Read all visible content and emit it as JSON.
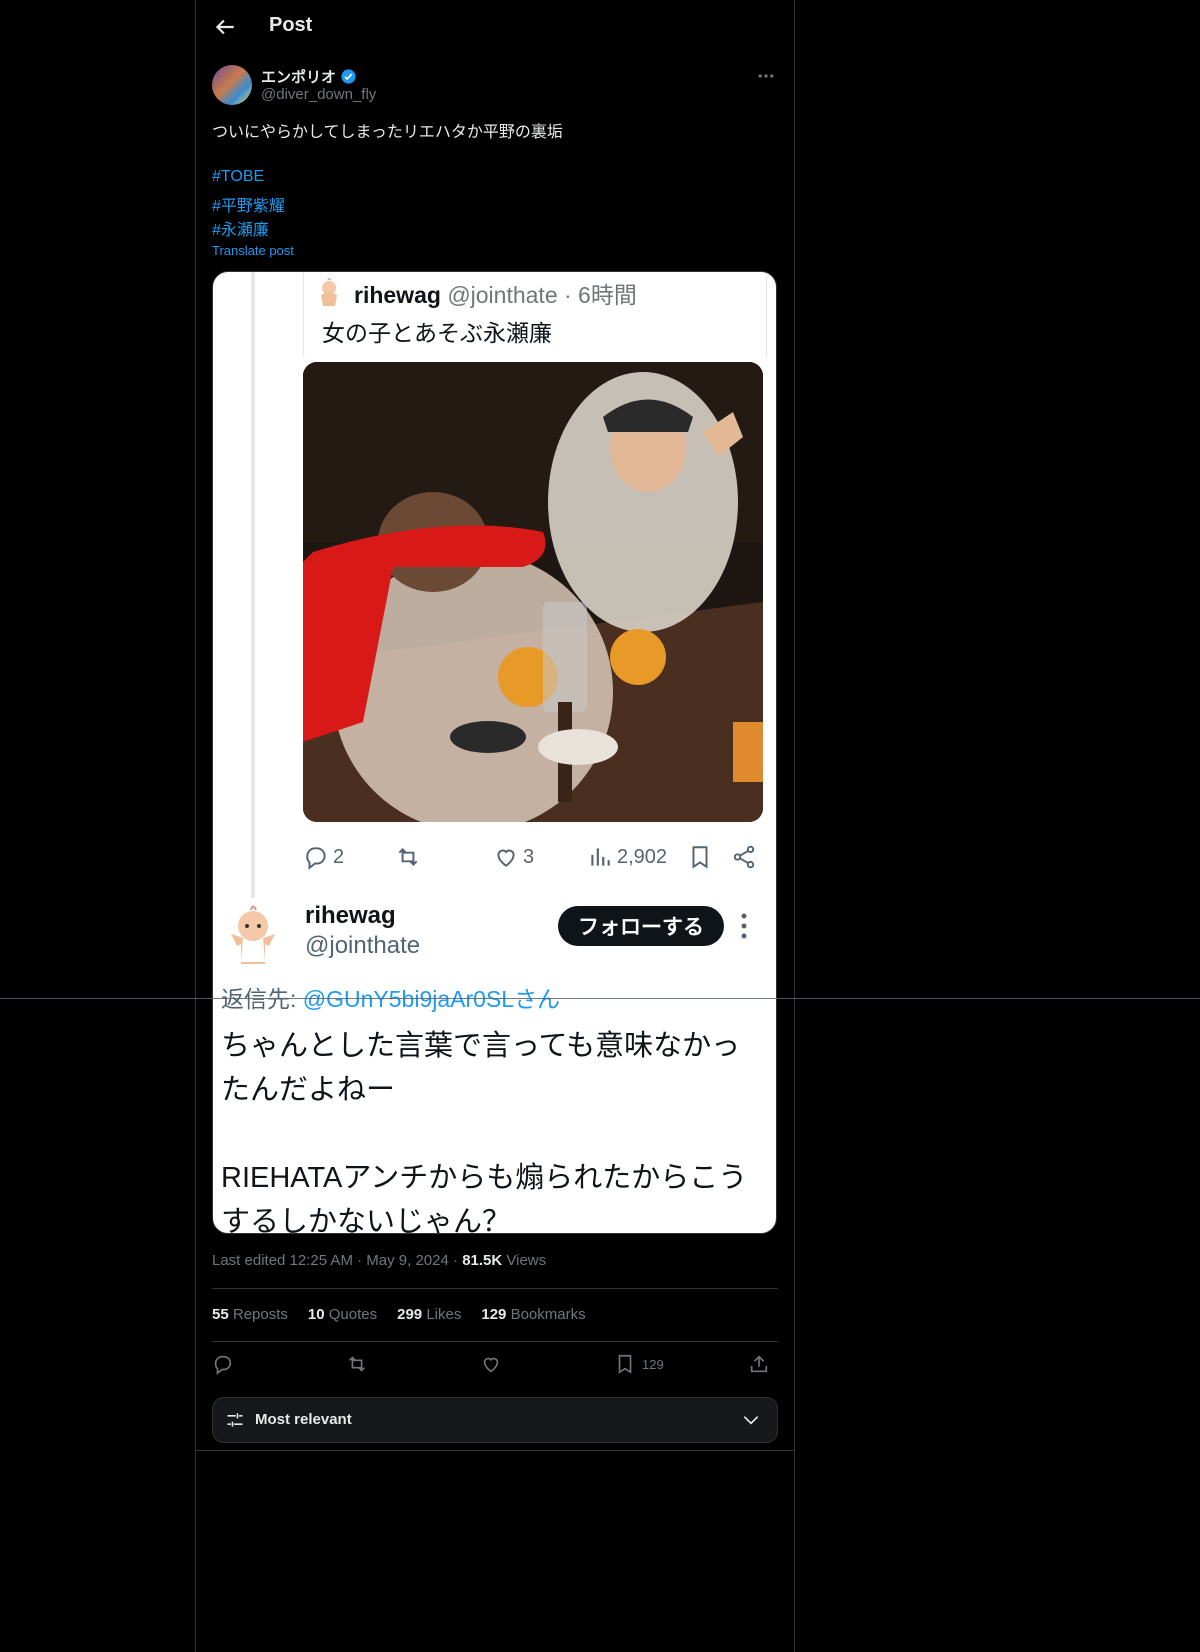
{
  "header": {
    "title": "Post"
  },
  "post": {
    "author_name": "エンポリオ",
    "author_handle": "@diver_down_fly",
    "text": "ついにやらかしてしまったリエハタか平野の裏垢",
    "hashtags": [
      "#TOBE",
      "#平野紫耀",
      "#永瀬廉"
    ],
    "translate_label": "Translate post",
    "media": {
      "quoted_user": "rihewag",
      "quoted_handle_time": "@jointhate · 6時間",
      "quoted_text": "女の子とあそぶ永瀬廉",
      "quoted_replies": "2",
      "quoted_likes": "3",
      "quoted_views": "2,902",
      "reply_user": "rihewag",
      "reply_handle": "@jointhate",
      "follow_label": "フォローする",
      "reply_to_prefix": "返信先: ",
      "reply_to_handle": "@GUnY5bi9jaAr0SLさん",
      "reply_text_1": "ちゃんとした言葉で言っても意味なかったんだよねー",
      "reply_text_2": "RIEHATAアンチからも煽られたからこうするしかないじゃん？"
    },
    "meta": {
      "edited": "Last edited 12:25 AM",
      "date": "May 9, 2024",
      "views_count": "81.5K",
      "views_label": "Views"
    },
    "stats": {
      "reposts": "55",
      "reposts_label": "Reposts",
      "quotes": "10",
      "quotes_label": "Quotes",
      "likes": "299",
      "likes_label": "Likes",
      "bookmarks": "129",
      "bookmarks_label": "Bookmarks"
    },
    "bookmark_count": "129"
  },
  "sort": {
    "label": "Most relevant"
  },
  "colors": {
    "accent": "#1d9bf0",
    "bg": "#000000",
    "text": "#e7e9ea",
    "muted": "#71767b"
  }
}
